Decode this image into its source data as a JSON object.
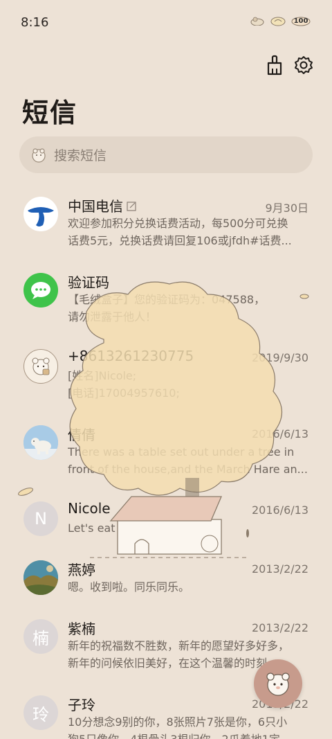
{
  "status_bar": {
    "time": "8:16",
    "battery": "100"
  },
  "toolbar": {
    "clean_icon": "broom-icon",
    "settings_icon": "gear-icon"
  },
  "page": {
    "title": "短信"
  },
  "search": {
    "placeholder": "搜索短信"
  },
  "messages": [
    {
      "name": "中国电信",
      "date": "9月30日",
      "line1": "欢迎参加积分兑换话费活动，每500分可兑换",
      "line2": "话费5元，兑换话费请回复106或jfdh#话费...",
      "avatar": "china-telecom-logo"
    },
    {
      "name": "验证码",
      "date": "",
      "line1": "【毛绒盒子】您的验证码为：047588，",
      "line2": "请勿泄露于他人！",
      "avatar": "message-bubble-icon"
    },
    {
      "name": "+8613261230775",
      "date": "2019/9/30",
      "line1": "[姓名]Nicole;",
      "line2": "[电话]17004957610;",
      "avatar": "bear-avatar"
    },
    {
      "name": "倩倩",
      "date": "2016/6/13",
      "line1": "There was a table set out under a tree in",
      "line2": "front of the house,and the March Hare an...",
      "avatar": "polar-bear-photo"
    },
    {
      "name": "Nicole",
      "date": "2016/6/13",
      "line1": "Let's eat out,shall we?",
      "line2": "",
      "avatar_letter": "N"
    },
    {
      "name": "燕婷",
      "date": "2013/2/22",
      "line1": "嗯。收到啦。同乐同乐。",
      "line2": "",
      "avatar": "landscape-photo"
    },
    {
      "name": "紫楠",
      "date": "2013/2/22",
      "line1": "新年的祝福数不胜数，新年的愿望好多好多，",
      "line2": "新年的问候依旧美好，在这个温馨的时刻，...",
      "avatar_letter": "楠"
    },
    {
      "name": "子玲",
      "date": "2013/2/22",
      "line1": "10分想念9别的你，8张照片7张是你，6只小",
      "line2": "狗5只像你，4根骨头3根归你，2爪着地1定",
      "avatar_letter": "玲"
    }
  ],
  "colors": {
    "background": "#ede2d6",
    "search_bg": "#e2d6c9",
    "fab": "#c79b8c",
    "telecom_blue": "#1f5fb5",
    "sms_green": "#3fc34a"
  }
}
